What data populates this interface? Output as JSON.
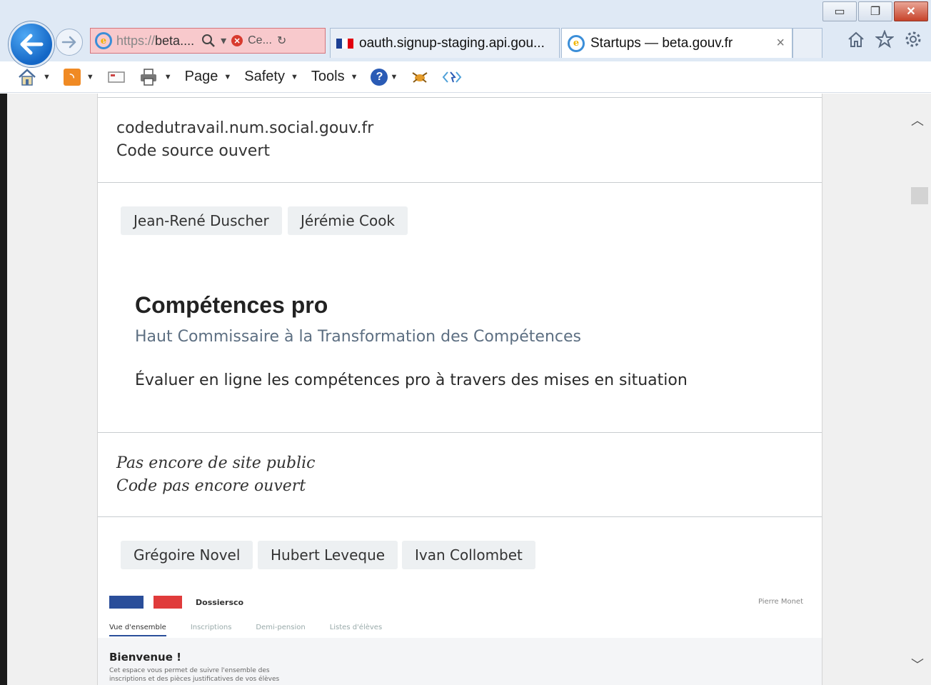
{
  "address_bar": {
    "url_scheme": "https://",
    "url_host": "beta....",
    "search_icon": "magnifier-icon",
    "cert_error_label": "Ce...",
    "refresh_icon": "refresh-icon"
  },
  "tabs": [
    {
      "label": "oauth.signup-staging.api.gou...",
      "icon": "french-flag-icon"
    },
    {
      "label": "Startups — beta.gouv.fr",
      "icon": "ie-icon",
      "close": "×"
    }
  ],
  "command_bar": {
    "page_label": "Page",
    "safety_label": "Safety",
    "tools_label": "Tools"
  },
  "content": {
    "link1": "codedutravail.num.social.gouv.fr",
    "link2": "Code source ouvert",
    "members_1": [
      "Jean-René Duscher",
      "Jérémie Cook"
    ],
    "startup": {
      "title": "Compétences pro",
      "sponsor": "Haut Commissaire à la Transformation des Compétences",
      "description": "Évaluer en ligne les compétences pro à travers des mises en situation"
    },
    "status1": "Pas encore de site public",
    "status2": "Code pas encore ouvert",
    "members_2": [
      "Grégoire Novel",
      "Hubert Leveque",
      "Ivan Collombet"
    ],
    "preview": {
      "brand": "Dossiersco",
      "user": "Pierre Monet",
      "nav": [
        "Vue d'ensemble",
        "Inscriptions",
        "Demi-pension",
        "Listes d'élèves"
      ],
      "welcome": "Bienvenue !",
      "welcome_desc_1": "Cet espace vous permet de suivre l'ensemble des",
      "welcome_desc_2": "inscriptions et des pièces justificatives de vos élèves"
    }
  },
  "colors": {
    "back_button": "#1467c6",
    "address_error_bg": "#f8c9cc",
    "chip_bg": "#edf0f2",
    "subtitle": "#5d6f82"
  }
}
